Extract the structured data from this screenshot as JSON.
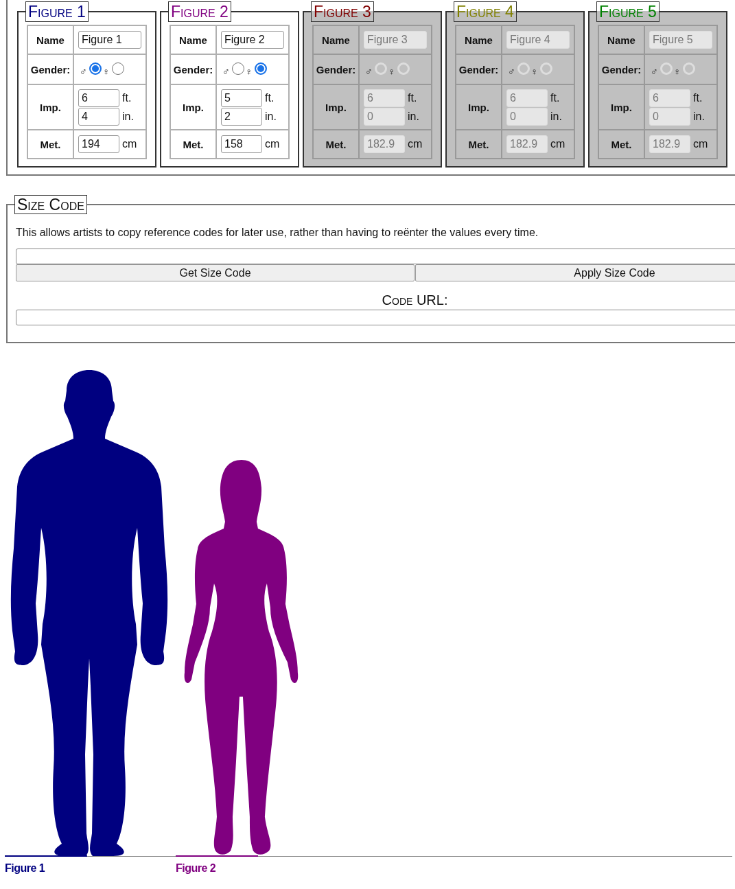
{
  "figures": [
    {
      "title": "Figure 1",
      "color": "#000080",
      "disabled": false,
      "chart_label": "Figure 1",
      "name_label": "Name",
      "name": "Figure 1",
      "gender_label": "Gender:",
      "genders": [
        {
          "symbol": "♂",
          "kind": "male",
          "selected": true
        },
        {
          "symbol": "♀",
          "kind": "female",
          "selected": false
        }
      ],
      "imp_label": "Imp.",
      "feet": "6",
      "feet_unit": "ft.",
      "inches": "4",
      "inches_unit": "in.",
      "met_label": "Met.",
      "cm": "194",
      "cm_unit": "cm"
    },
    {
      "title": "Figure 2",
      "color": "#800080",
      "disabled": false,
      "chart_label": "Figure 2",
      "name_label": "Name",
      "name": "Figure 2",
      "gender_label": "Gender:",
      "genders": [
        {
          "symbol": "♂",
          "kind": "male",
          "selected": false
        },
        {
          "symbol": "♀",
          "kind": "female",
          "selected": true
        }
      ],
      "imp_label": "Imp.",
      "feet": "5",
      "feet_unit": "ft.",
      "inches": "2",
      "inches_unit": "in.",
      "met_label": "Met.",
      "cm": "158",
      "cm_unit": "cm"
    },
    {
      "title": "Figure 3",
      "color": "#800000",
      "disabled": true,
      "name_label": "Name",
      "name": "Figure 3",
      "gender_label": "Gender:",
      "genders": [
        {
          "symbol": "♂",
          "kind": "male",
          "selected": false
        },
        {
          "symbol": "♀",
          "kind": "female",
          "selected": false
        }
      ],
      "imp_label": "Imp.",
      "feet": "6",
      "feet_unit": "ft.",
      "inches": "0",
      "inches_unit": "in.",
      "met_label": "Met.",
      "cm": "182.9",
      "cm_unit": "cm"
    },
    {
      "title": "Figure 4",
      "color": "#808000",
      "disabled": true,
      "name_label": "Name",
      "name": "Figure 4",
      "gender_label": "Gender:",
      "genders": [
        {
          "symbol": "♂",
          "kind": "male",
          "selected": false
        },
        {
          "symbol": "♀",
          "kind": "female",
          "selected": false
        }
      ],
      "imp_label": "Imp.",
      "feet": "6",
      "feet_unit": "ft.",
      "inches": "0",
      "inches_unit": "in.",
      "met_label": "Met.",
      "cm": "182.9",
      "cm_unit": "cm"
    },
    {
      "title": "Figure 5",
      "color": "#008000",
      "disabled": true,
      "name_label": "Name",
      "name": "Figure 5",
      "gender_label": "Gender:",
      "genders": [
        {
          "symbol": "♂",
          "kind": "male",
          "selected": false
        },
        {
          "symbol": "♀",
          "kind": "female",
          "selected": false
        }
      ],
      "imp_label": "Imp.",
      "feet": "6",
      "feet_unit": "ft.",
      "inches": "0",
      "inches_unit": "in.",
      "met_label": "Met.",
      "cm": "182.9",
      "cm_unit": "cm"
    }
  ],
  "size_code": {
    "title": "Size Code",
    "description": "This allows artists to copy reference codes for later use, rather than having to reënter the values every time.",
    "get_button": "Get Size Code",
    "apply_button": "Apply Size Code",
    "url_label": "Code URL:"
  }
}
